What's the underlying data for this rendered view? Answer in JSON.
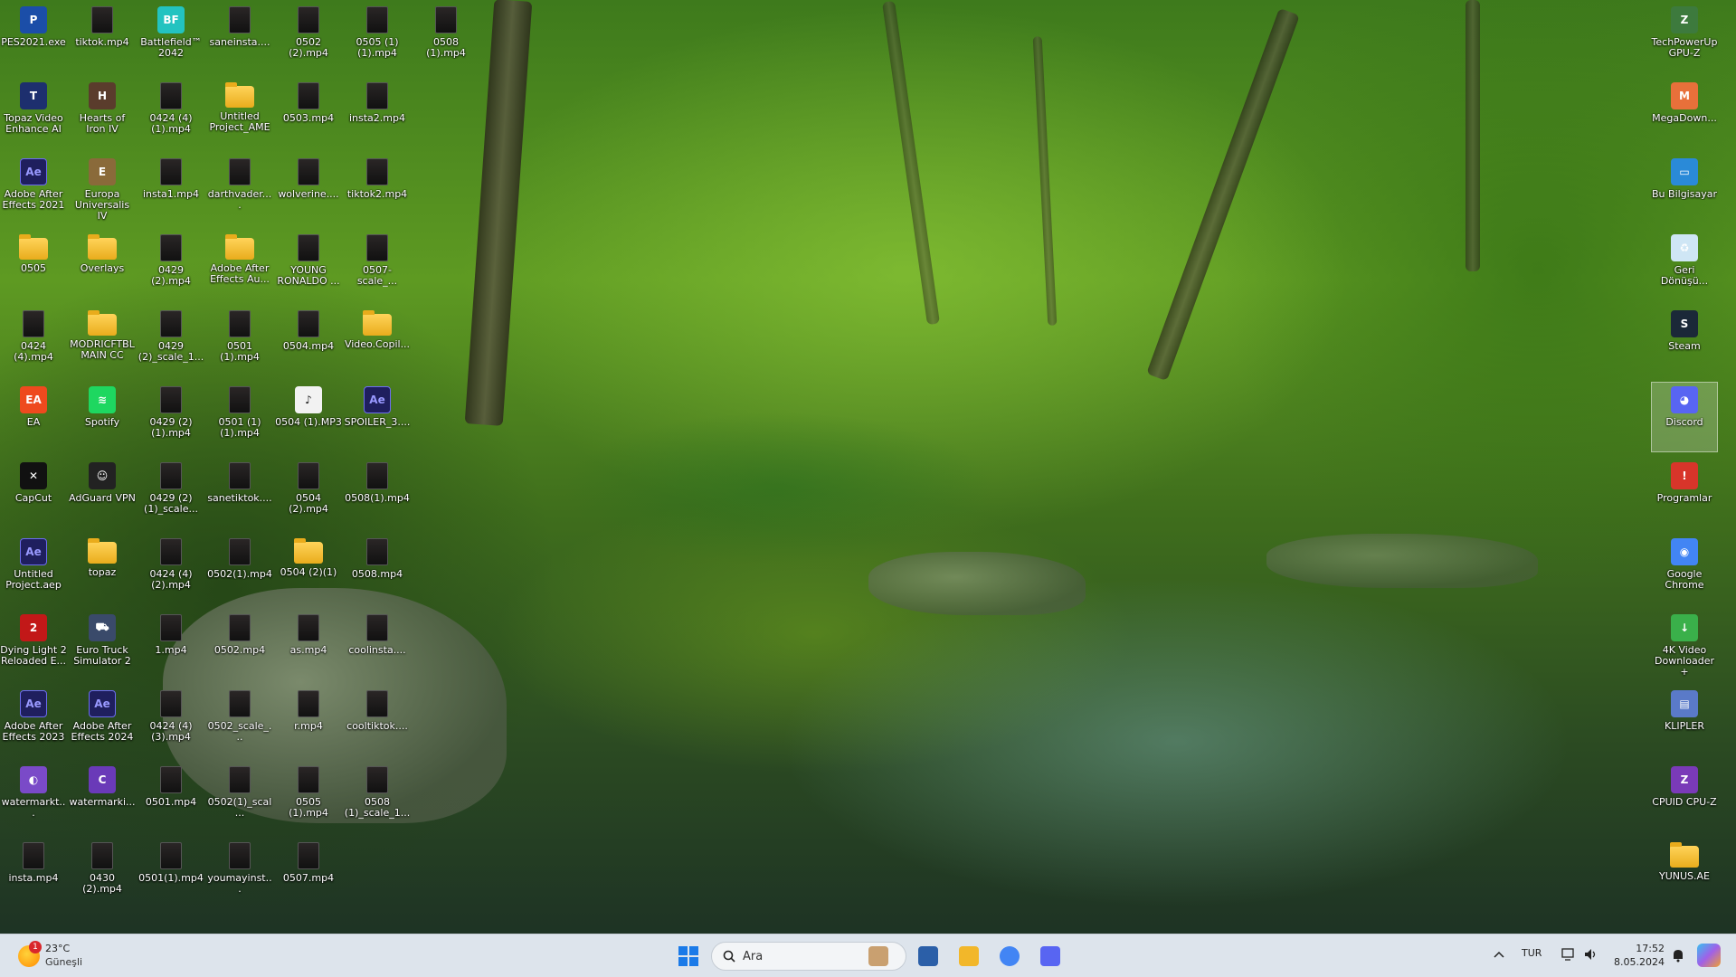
{
  "desktop": {
    "icons": [
      {
        "label": "PES2021.exe",
        "type": "app",
        "glyph": "P",
        "color": "#1b4ea8",
        "col": 0,
        "row": 0
      },
      {
        "label": "tiktok.mp4",
        "type": "video",
        "col": 1,
        "row": 0
      },
      {
        "label": "Battlefield™ 2042",
        "type": "app",
        "glyph": "BF",
        "color": "#23c3c0",
        "col": 2,
        "row": 0
      },
      {
        "label": "saneinsta....",
        "type": "video",
        "col": 3,
        "row": 0
      },
      {
        "label": "0502 (2).mp4",
        "type": "video",
        "col": 4,
        "row": 0
      },
      {
        "label": "0505 (1)(1).mp4",
        "type": "video",
        "col": 5,
        "row": 0
      },
      {
        "label": "0508 (1).mp4",
        "type": "video",
        "col": 6,
        "row": 0
      },
      {
        "label": "Topaz Video Enhance AI",
        "type": "app",
        "glyph": "T",
        "color": "#1d2f6e",
        "col": 0,
        "row": 1
      },
      {
        "label": "Hearts of Iron IV",
        "type": "app",
        "glyph": "H",
        "color": "#5a3c2c",
        "col": 1,
        "row": 1
      },
      {
        "label": "0424 (4)(1).mp4",
        "type": "video",
        "col": 2,
        "row": 1
      },
      {
        "label": "Untitled Project_AME",
        "type": "folder",
        "col": 3,
        "row": 1
      },
      {
        "label": "0503.mp4",
        "type": "video",
        "col": 4,
        "row": 1
      },
      {
        "label": "insta2.mp4",
        "type": "video",
        "col": 5,
        "row": 1
      },
      {
        "label": "Adobe After Effects 2021",
        "type": "ae",
        "glyph": "Ae",
        "col": 0,
        "row": 2
      },
      {
        "label": "Europa Universalis IV",
        "type": "app",
        "glyph": "E",
        "color": "#8a6a3a",
        "col": 1,
        "row": 2
      },
      {
        "label": "insta1.mp4",
        "type": "video",
        "col": 2,
        "row": 2
      },
      {
        "label": "darthvader....",
        "type": "video",
        "col": 3,
        "row": 2
      },
      {
        "label": "wolverine....",
        "type": "video",
        "col": 4,
        "row": 2
      },
      {
        "label": "tiktok2.mp4",
        "type": "video",
        "col": 5,
        "row": 2
      },
      {
        "label": "0505",
        "type": "folder",
        "col": 0,
        "row": 3
      },
      {
        "label": "Overlays",
        "type": "folder",
        "col": 1,
        "row": 3
      },
      {
        "label": "0429 (2).mp4",
        "type": "video",
        "col": 2,
        "row": 3
      },
      {
        "label": "Adobe After Effects Au...",
        "type": "folder",
        "col": 3,
        "row": 3
      },
      {
        "label": "YOUNG RONALDO ...",
        "type": "video",
        "col": 4,
        "row": 3
      },
      {
        "label": "0507-scale_...",
        "type": "video",
        "col": 5,
        "row": 3
      },
      {
        "label": "0424 (4).mp4",
        "type": "video",
        "col": 0,
        "row": 4
      },
      {
        "label": "MODRICFTBL MAIN CC",
        "type": "folder",
        "col": 1,
        "row": 4
      },
      {
        "label": "0429 (2)_scale_1...",
        "type": "video",
        "col": 2,
        "row": 4
      },
      {
        "label": "0501 (1).mp4",
        "type": "video",
        "col": 3,
        "row": 4
      },
      {
        "label": "0504.mp4",
        "type": "video",
        "col": 4,
        "row": 4
      },
      {
        "label": "Video.Copil...",
        "type": "folder",
        "col": 5,
        "row": 4
      },
      {
        "label": "EA",
        "type": "app",
        "glyph": "EA",
        "color": "#ee4a1e",
        "col": 0,
        "row": 5
      },
      {
        "label": "Spotify",
        "type": "app",
        "glyph": "≋",
        "color": "#1ed760",
        "col": 1,
        "row": 5
      },
      {
        "label": "0429 (2)(1).mp4",
        "type": "video",
        "col": 2,
        "row": 5
      },
      {
        "label": "0501 (1)(1).mp4",
        "type": "video",
        "col": 3,
        "row": 5
      },
      {
        "label": "0504 (1).MP3",
        "type": "app",
        "glyph": "♪",
        "color": "#f2f2f2",
        "col": 4,
        "row": 5
      },
      {
        "label": "SPOILER_3....",
        "type": "ae",
        "glyph": "Ae",
        "col": 5,
        "row": 5
      },
      {
        "label": "CapCut",
        "type": "app",
        "glyph": "✕",
        "color": "#111111",
        "col": 0,
        "row": 6
      },
      {
        "label": "AdGuard VPN",
        "type": "app",
        "glyph": "☺",
        "color": "#222222",
        "col": 1,
        "row": 6
      },
      {
        "label": "0429 (2)(1)_scale...",
        "type": "video",
        "col": 2,
        "row": 6
      },
      {
        "label": "sanetiktok....",
        "type": "video",
        "col": 3,
        "row": 6
      },
      {
        "label": "0504 (2).mp4",
        "type": "video",
        "col": 4,
        "row": 6
      },
      {
        "label": "0508(1).mp4",
        "type": "video",
        "col": 5,
        "row": 6
      },
      {
        "label": "Untitled Project.aep",
        "type": "ae",
        "glyph": "Ae",
        "col": 0,
        "row": 7
      },
      {
        "label": "topaz",
        "type": "folder",
        "col": 1,
        "row": 7
      },
      {
        "label": "0424 (4)(2).mp4",
        "type": "video",
        "col": 2,
        "row": 7
      },
      {
        "label": "0502(1).mp4",
        "type": "video",
        "col": 3,
        "row": 7
      },
      {
        "label": "0504 (2)(1)",
        "type": "folder",
        "col": 4,
        "row": 7
      },
      {
        "label": "0508.mp4",
        "type": "video",
        "col": 5,
        "row": 7
      },
      {
        "label": "Dying Light 2 Reloaded E...",
        "type": "app",
        "glyph": "2",
        "color": "#c21818",
        "col": 0,
        "row": 8
      },
      {
        "label": "Euro Truck Simulator 2",
        "type": "app",
        "glyph": "⛟",
        "color": "#3a4a6a",
        "col": 1,
        "row": 8
      },
      {
        "label": "1.mp4",
        "type": "video",
        "col": 2,
        "row": 8
      },
      {
        "label": "0502.mp4",
        "type": "video",
        "col": 3,
        "row": 8
      },
      {
        "label": "as.mp4",
        "type": "video",
        "col": 4,
        "row": 8
      },
      {
        "label": "coolinsta....",
        "type": "video",
        "col": 5,
        "row": 8
      },
      {
        "label": "Adobe After Effects 2023",
        "type": "ae",
        "glyph": "Ae",
        "col": 0,
        "row": 9
      },
      {
        "label": "Adobe After Effects 2024",
        "type": "ae",
        "glyph": "Ae",
        "col": 1,
        "row": 9
      },
      {
        "label": "0424 (4)(3).mp4",
        "type": "video",
        "col": 2,
        "row": 9
      },
      {
        "label": "0502_scale_...",
        "type": "video",
        "col": 3,
        "row": 9
      },
      {
        "label": "r.mp4",
        "type": "video",
        "col": 4,
        "row": 9
      },
      {
        "label": "cooltiktok....",
        "type": "video",
        "col": 5,
        "row": 9
      },
      {
        "label": "watermarkt...",
        "type": "app",
        "glyph": "◐",
        "color": "#7a4ac8",
        "col": 0,
        "row": 10
      },
      {
        "label": "watermarki...",
        "type": "app",
        "glyph": "C",
        "color": "#6a3ab8",
        "col": 1,
        "row": 10
      },
      {
        "label": "0501.mp4",
        "type": "video",
        "col": 2,
        "row": 10
      },
      {
        "label": "0502(1)_scal...",
        "type": "video",
        "col": 3,
        "row": 10
      },
      {
        "label": "0505 (1).mp4",
        "type": "video",
        "col": 4,
        "row": 10
      },
      {
        "label": "0508 (1)_scale_1...",
        "type": "video",
        "col": 5,
        "row": 10
      },
      {
        "label": "insta.mp4",
        "type": "video",
        "col": 0,
        "row": 11
      },
      {
        "label": "0430 (2).mp4",
        "type": "video",
        "col": 1,
        "row": 11
      },
      {
        "label": "0501(1).mp4",
        "type": "video",
        "col": 2,
        "row": 11
      },
      {
        "label": "youmayinst...",
        "type": "video",
        "col": 3,
        "row": 11
      },
      {
        "label": "0507.mp4",
        "type": "video",
        "col": 4,
        "row": 11
      }
    ],
    "right_icons": [
      {
        "label": "TechPowerUp GPU-Z",
        "type": "app",
        "glyph": "Z",
        "color": "#3d7a3d",
        "row": 0
      },
      {
        "label": "MegaDown...",
        "type": "app",
        "glyph": "M",
        "color": "#e8703a",
        "row": 1
      },
      {
        "label": "Bu Bilgisayar",
        "type": "app",
        "glyph": "▭",
        "color": "#2a8ad8",
        "row": 2
      },
      {
        "label": "Geri Dönüşü...",
        "type": "app",
        "glyph": "♻",
        "color": "#cfe6f5",
        "row": 3
      },
      {
        "label": "Steam",
        "type": "app",
        "glyph": "S",
        "color": "#1b2838",
        "row": 4
      },
      {
        "label": "Discord",
        "type": "app",
        "glyph": "◕",
        "color": "#5865f2",
        "row": 5,
        "selected": true
      },
      {
        "label": "Programlar",
        "type": "app",
        "glyph": "!",
        "color": "#d8352a",
        "row": 6
      },
      {
        "label": "Google Chrome",
        "type": "app",
        "glyph": "◉",
        "color": "#4285f4",
        "row": 7
      },
      {
        "label": "4K Video Downloader+",
        "type": "app",
        "glyph": "↓",
        "color": "#3ab04a",
        "row": 8
      },
      {
        "label": "KLİPLER",
        "type": "app",
        "glyph": "▤",
        "color": "#5a7ac8",
        "row": 9
      },
      {
        "label": "CPUID CPU-Z",
        "type": "app",
        "glyph": "Z",
        "color": "#7a3ab8",
        "row": 10
      },
      {
        "label": "YUNUS.AE",
        "type": "folder",
        "row": 11
      }
    ]
  },
  "taskbar": {
    "weather": {
      "temp": "23°C",
      "condition": "Güneşli",
      "badge": "1"
    },
    "search_placeholder": "Ara",
    "pinned": [
      {
        "name": "widgets-icon",
        "color": "#c9a070"
      },
      {
        "name": "store-icon",
        "color": "#2b5fa8"
      },
      {
        "name": "file-explorer-icon",
        "color": "#f2b72a"
      },
      {
        "name": "chrome-icon",
        "color": "#4285f4"
      },
      {
        "name": "discord-taskbar-icon",
        "color": "#5865f2"
      }
    ],
    "tray": {
      "language": "TUR",
      "time": "17:52",
      "date": "8.05.2024"
    }
  }
}
